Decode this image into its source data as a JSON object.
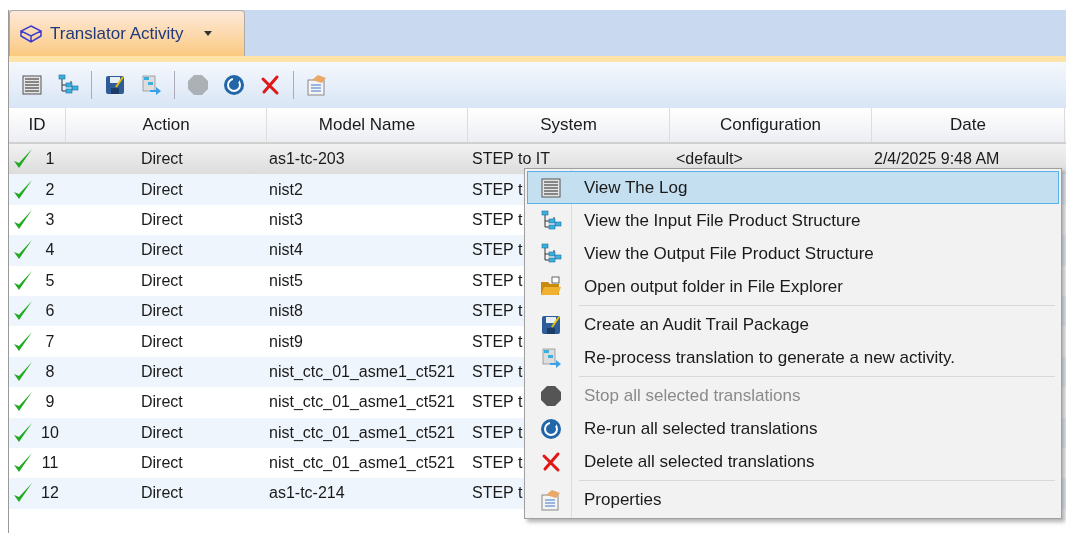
{
  "tab": {
    "title": "Translator Activity",
    "selected": true
  },
  "toolbar": [
    {
      "kind": "log",
      "disabled": false
    },
    {
      "kind": "tree",
      "disabled": false
    },
    {
      "kind": "separator"
    },
    {
      "kind": "save",
      "disabled": false
    },
    {
      "kind": "reprocess",
      "disabled": false
    },
    {
      "kind": "separator"
    },
    {
      "kind": "stop",
      "disabled": true
    },
    {
      "kind": "rerun",
      "disabled": false
    },
    {
      "kind": "delete",
      "disabled": false
    },
    {
      "kind": "separator"
    },
    {
      "kind": "properties",
      "disabled": false
    }
  ],
  "table": {
    "columns": [
      "ID",
      "Action",
      "Model Name",
      "System",
      "Configuration",
      "Date"
    ],
    "rows": [
      {
        "id": "1",
        "action": "Direct",
        "model": "as1-tc-203",
        "system": "STEP to IT",
        "configuration": "<default>",
        "date": "2/4/2025 9:48 AM",
        "selected": true
      },
      {
        "id": "2",
        "action": "Direct",
        "model": "nist2",
        "system": "STEP t",
        "selected": false
      },
      {
        "id": "3",
        "action": "Direct",
        "model": "nist3",
        "system": "STEP t",
        "selected": false
      },
      {
        "id": "4",
        "action": "Direct",
        "model": "nist4",
        "system": "STEP t",
        "selected": false
      },
      {
        "id": "5",
        "action": "Direct",
        "model": "nist5",
        "system": "STEP t",
        "selected": false
      },
      {
        "id": "6",
        "action": "Direct",
        "model": "nist8",
        "system": "STEP t",
        "selected": false
      },
      {
        "id": "7",
        "action": "Direct",
        "model": "nist9",
        "system": "STEP t",
        "selected": false
      },
      {
        "id": "8",
        "action": "Direct",
        "model": "nist_ctc_01_asme1_ct521",
        "system": "STEP t",
        "selected": false
      },
      {
        "id": "9",
        "action": "Direct",
        "model": "nist_ctc_01_asme1_ct521",
        "system": "STEP t",
        "selected": false
      },
      {
        "id": "10",
        "action": "Direct",
        "model": "nist_ctc_01_asme1_ct521",
        "system": "STEP t",
        "selected": false
      },
      {
        "id": "11",
        "action": "Direct",
        "model": "nist_ctc_01_asme1_ct521",
        "system": "STEP t",
        "selected": false
      },
      {
        "id": "12",
        "action": "Direct",
        "model": "as1-tc-214",
        "system": "STEP t",
        "selected": false
      }
    ]
  },
  "context_menu": [
    {
      "kind": "log",
      "label": "View The Log",
      "selected": true,
      "disabled": false
    },
    {
      "kind": "tree",
      "label": "View the Input File Product Structure",
      "selected": false,
      "disabled": false
    },
    {
      "kind": "tree",
      "label": "View the Output File Product Structure",
      "selected": false,
      "disabled": false
    },
    {
      "kind": "folder",
      "label": "Open output folder in File Explorer",
      "selected": false,
      "disabled": false
    },
    {
      "kind": "separator"
    },
    {
      "kind": "save",
      "label": "Create an Audit Trail Package",
      "selected": false,
      "disabled": false
    },
    {
      "kind": "reprocess",
      "label": "Re-process translation to generate a new activity.",
      "selected": false,
      "disabled": false
    },
    {
      "kind": "separator"
    },
    {
      "kind": "stop",
      "label": "Stop all selected translations",
      "selected": false,
      "disabled": true
    },
    {
      "kind": "rerun",
      "label": "Re-run all selected translations",
      "selected": false,
      "disabled": false
    },
    {
      "kind": "delete",
      "label": "Delete all selected translations",
      "selected": false,
      "disabled": false
    },
    {
      "kind": "separator"
    },
    {
      "kind": "properties",
      "label": "Properties",
      "selected": false,
      "disabled": false
    }
  ]
}
